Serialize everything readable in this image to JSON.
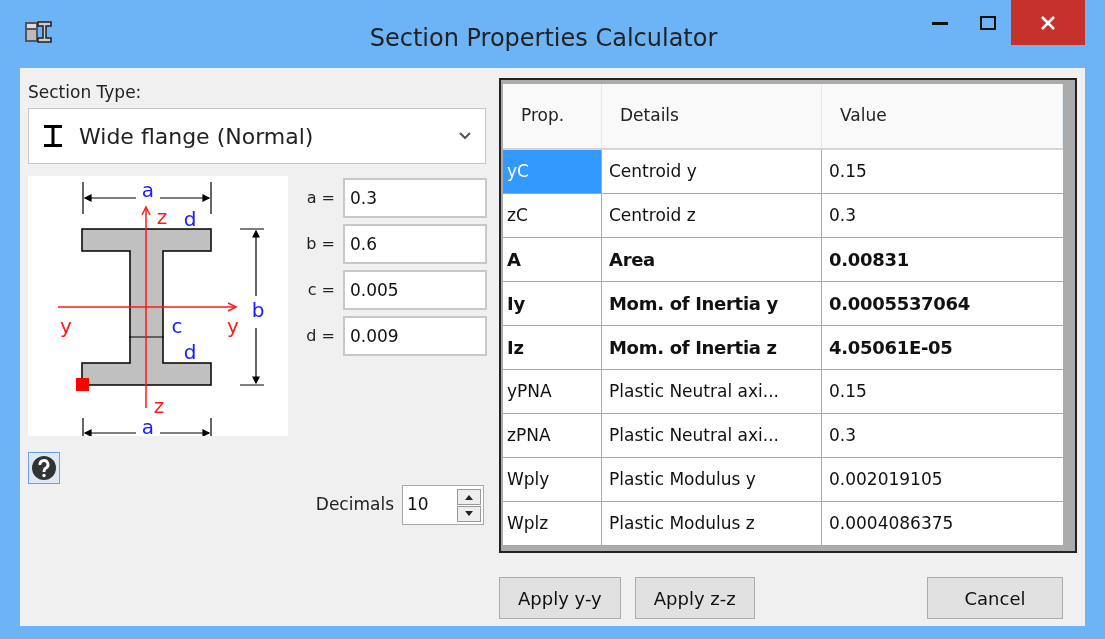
{
  "window": {
    "title": "Section Properties Calculator"
  },
  "section_type": {
    "label": "Section Type:",
    "value": "Wide flange (Normal)"
  },
  "diagram": {
    "labels": [
      {
        "text": "a",
        "kind": "dimension"
      },
      {
        "text": "z",
        "kind": "axis"
      },
      {
        "text": "d",
        "kind": "dimension"
      },
      {
        "text": "y",
        "kind": "axis"
      },
      {
        "text": "c",
        "kind": "dimension"
      },
      {
        "text": "y",
        "kind": "axis"
      },
      {
        "text": "b",
        "kind": "dimension"
      },
      {
        "text": "d",
        "kind": "dimension"
      },
      {
        "text": "z",
        "kind": "axis"
      },
      {
        "text": "a",
        "kind": "dimension"
      }
    ]
  },
  "parameters": [
    {
      "label": "a =",
      "value": "0.3"
    },
    {
      "label": "b =",
      "value": "0.6"
    },
    {
      "label": "c =",
      "value": "0.005"
    },
    {
      "label": "d =",
      "value": "0.009"
    }
  ],
  "decimals": {
    "label": "Decimals",
    "value": "10"
  },
  "table": {
    "columns": [
      "Prop.",
      "Details",
      "Value"
    ],
    "rows": [
      {
        "prop": "yC",
        "details": "Centroid y",
        "value": "0.15",
        "emphasized": false,
        "selected": true
      },
      {
        "prop": "zC",
        "details": "Centroid z",
        "value": "0.3",
        "emphasized": false,
        "selected": false
      },
      {
        "prop": "A",
        "details": "Area",
        "value": "0.00831",
        "emphasized": true,
        "selected": false
      },
      {
        "prop": "Iy",
        "details": "Mom. of Inertia y",
        "value": "0.0005537064",
        "emphasized": true,
        "selected": false
      },
      {
        "prop": "Iz",
        "details": "Mom. of Inertia z",
        "value": "4.05061E-05",
        "emphasized": true,
        "selected": false
      },
      {
        "prop": "yPNA",
        "details": "Plastic Neutral axi...",
        "value": "0.15",
        "emphasized": false,
        "selected": false
      },
      {
        "prop": "zPNA",
        "details": "Plastic Neutral axi...",
        "value": "0.3",
        "emphasized": false,
        "selected": false
      },
      {
        "prop": "Wply",
        "details": "Plastic Modulus y",
        "value": "0.002019105",
        "emphasized": false,
        "selected": false
      },
      {
        "prop": "Wplz",
        "details": "Plastic Modulus z",
        "value": "0.0004086375",
        "emphasized": false,
        "selected": false
      }
    ]
  },
  "buttons": {
    "left": [
      "Apply y-y",
      "Apply z-z"
    ],
    "right": [
      "Cancel"
    ]
  }
}
